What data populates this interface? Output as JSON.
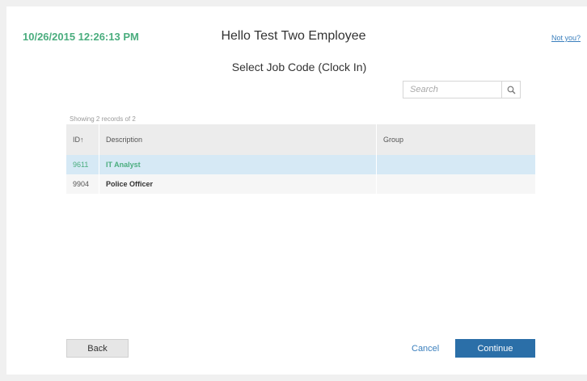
{
  "header": {
    "datetime": "10/26/2015 12:26:13 PM",
    "greeting": "Hello Test Two Employee",
    "not_you_link": "Not you?"
  },
  "page": {
    "subtitle": "Select Job Code (Clock In)"
  },
  "search": {
    "placeholder": "Search",
    "value": ""
  },
  "grid": {
    "records_info": "Showing 2 records of 2",
    "columns": {
      "id": "ID↑",
      "description": "Description",
      "group": "Group"
    },
    "rows": [
      {
        "id": "9611",
        "description": "IT Analyst",
        "group": "",
        "selected": true
      },
      {
        "id": "9904",
        "description": "Police Officer",
        "group": "",
        "selected": false
      }
    ]
  },
  "footer": {
    "back_label": "Back",
    "cancel_label": "Cancel",
    "continue_label": "Continue"
  },
  "colors": {
    "accent_green": "#4aad7e",
    "primary_blue": "#2b6fa8",
    "link_blue": "#3a7fbd",
    "selected_row": "#d6e9f5"
  }
}
